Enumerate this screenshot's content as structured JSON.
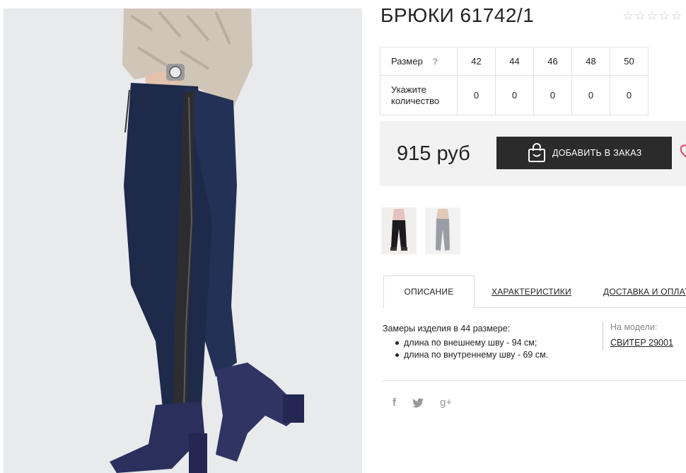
{
  "product": {
    "title": "БРЮКИ 61742/1",
    "rating_stars": [
      "☆",
      "☆",
      "☆",
      "☆",
      "☆"
    ]
  },
  "size_table": {
    "size_label": "Размер",
    "help_icon": "?",
    "sizes": [
      "42",
      "44",
      "46",
      "48",
      "50"
    ],
    "qty_label": "Укажите количество",
    "quantities": [
      "0",
      "0",
      "0",
      "0",
      "0"
    ]
  },
  "purchase": {
    "price": "915 руб",
    "add_button_label": "ДОБАВИТЬ В ЗАКАЗ",
    "add_button_icon": "shopping-bag-icon",
    "wishlist_icon": "heart-icon"
  },
  "tabs": [
    {
      "label": "ОПИСАНИЕ",
      "active": true
    },
    {
      "label": "ХАРАКТЕРИСТИКИ",
      "active": false
    },
    {
      "label": "ДОСТАВКА И ОПЛАТА",
      "active": false
    }
  ],
  "description": {
    "intro": "Замеры изделия в 44 размере:",
    "items": [
      "длина по внешнему шву - 94 см;",
      "длина по внутреннему шву - 69 см."
    ]
  },
  "model": {
    "label": "На модели:",
    "link": "СВИТЕР 29001"
  },
  "social": {
    "facebook": "f",
    "twitter": "🐦",
    "google_plus": "g+"
  },
  "colors": {
    "button_bg": "#2b2b2b",
    "price_box_bg": "#f2f2f2",
    "heart": "#d9486b",
    "pants": "#1d2a4a"
  }
}
